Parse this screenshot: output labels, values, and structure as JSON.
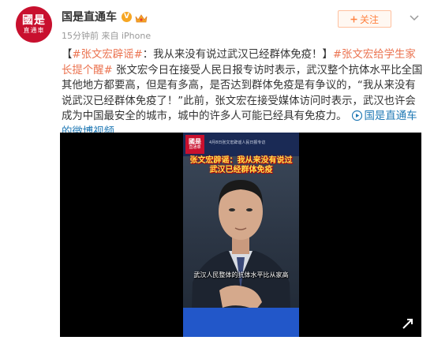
{
  "header": {
    "avatar_big": "國是",
    "avatar_small": "直通車",
    "username": "国是直通车",
    "verified_badge": "V",
    "meta": "15分钟前 来自 iPhone",
    "follow_label": "关注"
  },
  "post": {
    "open_bracket": "【",
    "topic1": "#张文宏辟谣#",
    "headline": "：我从来没有说过武汉已经群体免疫！】",
    "topic2": "#张文宏给学生家长提个醒#",
    "body": " 张文宏今日在接受人民日报专访时表示，武汉整个抗体水平比全国其他地方都要高，但是有多高，是否达到群体免疫是有争议的，“我从来没有说武汉已经群体免疫了！”此前，张文宏在接受媒体访问时表示，武汉也许会成为中国最安全的城市，城中的许多人可能已经具有免疫力。",
    "video_link": "国是直通车的微博视频"
  },
  "video": {
    "channel_big": "國是",
    "channel_small": "直通車",
    "ticker": "4月8日张文宏辟谣人民日报专访",
    "headline": "张文宏辟谣：我从来没有说过武汉已经群体免疫",
    "subtitle": "武汉人民整体的抗体水平比从家高"
  },
  "colors": {
    "accent": "#eb7350",
    "link_blue": "#1f78b4",
    "brand_red": "#c8102e",
    "follow_orange": "#ff8140"
  },
  "icons": [
    "vip-crown-icon",
    "plus-icon",
    "chevron-down-icon",
    "video-play-icon",
    "expand-arrow-icon"
  ]
}
